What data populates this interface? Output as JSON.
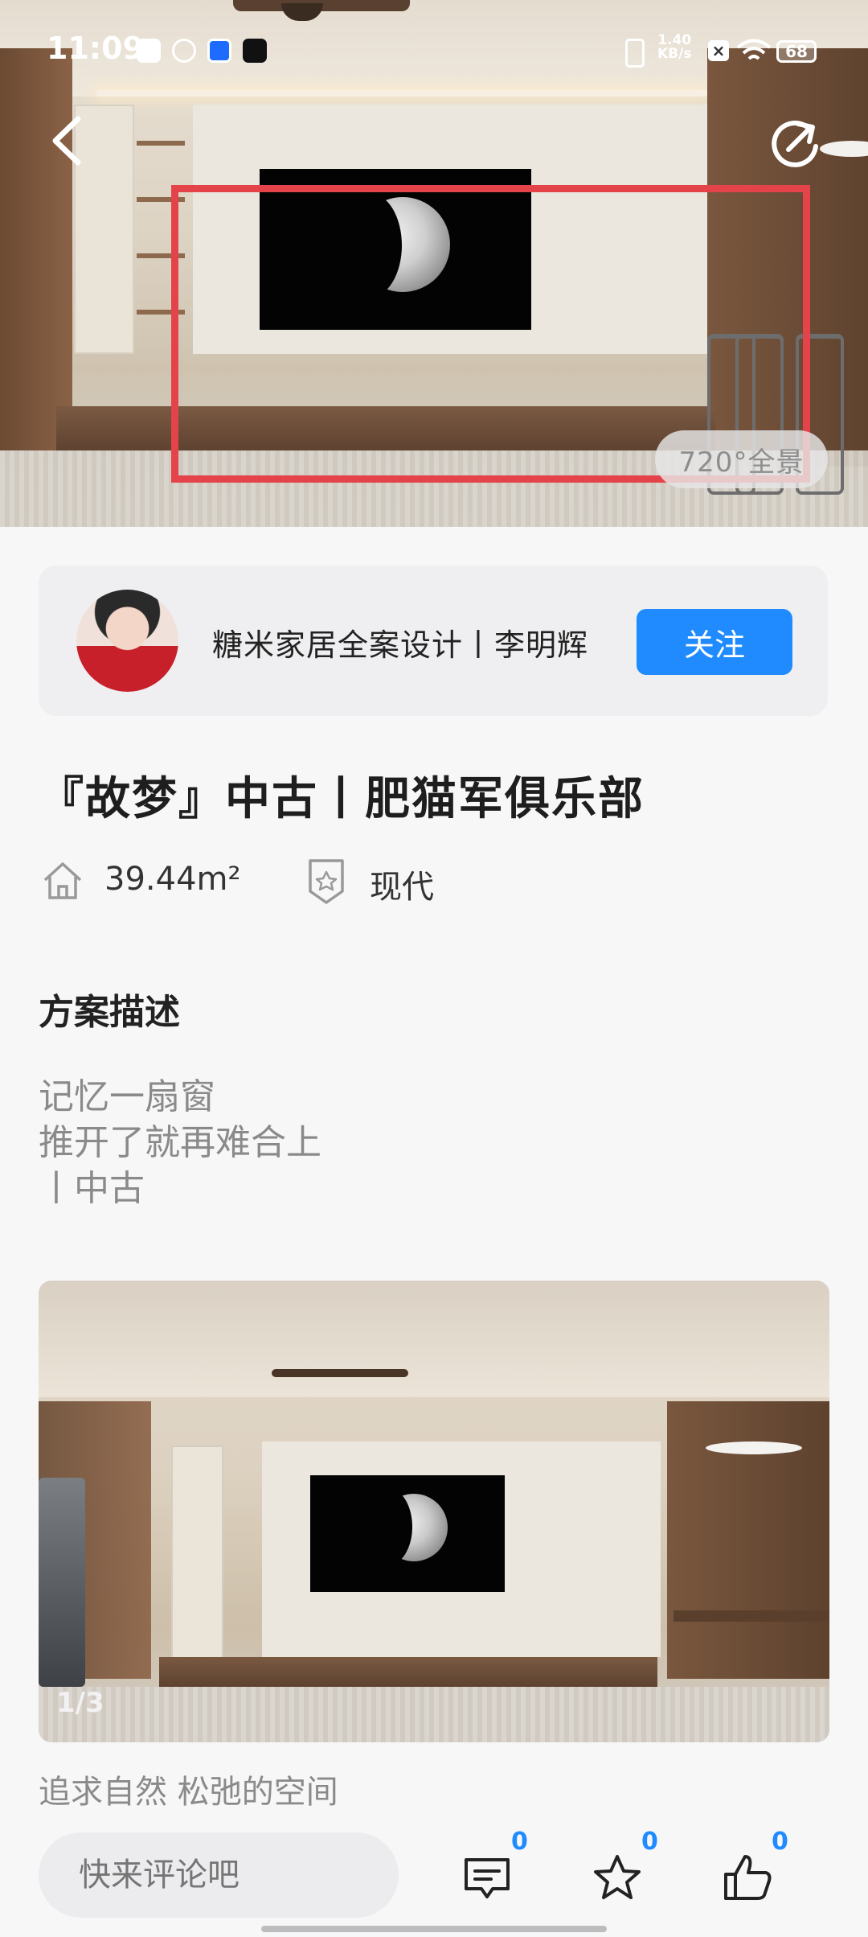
{
  "status_bar": {
    "time": "11:09",
    "net_speed_value": "1.40",
    "net_speed_unit": "KB/s",
    "battery": "68"
  },
  "hero": {
    "badge": "720°全景"
  },
  "designer": {
    "name": "糖米家居全案设计丨李明辉",
    "follow_label": "关注"
  },
  "case": {
    "title": "『故梦』中古丨肥猫军俱乐部",
    "area": "39.44m²",
    "style": "现代"
  },
  "description": {
    "heading": "方案描述",
    "lines": [
      "记忆一扇窗",
      "推开了就再难合上",
      "丨中古"
    ]
  },
  "gallery": {
    "counter": "1/3",
    "caption": "追求自然 松弛的空间"
  },
  "bottom_bar": {
    "comment_placeholder": "快来评论吧",
    "comment_count": "0",
    "favorite_count": "0",
    "like_count": "0"
  },
  "colors": {
    "accent": "#1f8bff",
    "highlight_box": "#e5434a"
  }
}
